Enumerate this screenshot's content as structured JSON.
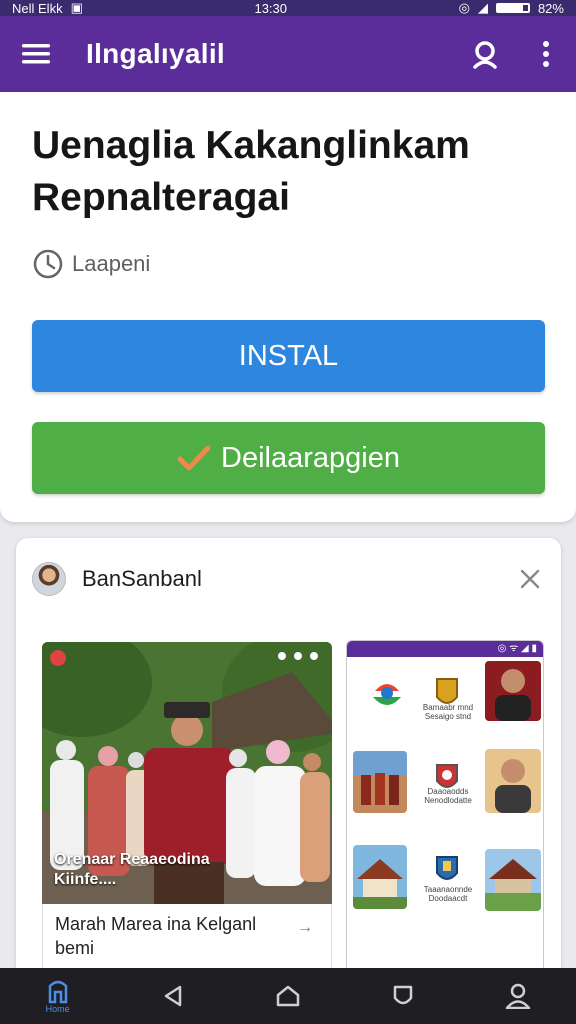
{
  "status_bar": {
    "left_text": "Nell Elkk",
    "time": "13:30",
    "battery_text": "82%",
    "battery_level": 0.82
  },
  "app_bar": {
    "title": "Ilngalıyalil",
    "menu_icon": "hamburger-menu-icon",
    "search_icon": "search-icon",
    "more_icon": "more-vertical-icon",
    "color": "#5b2d9a"
  },
  "app_detail": {
    "title": "Uenaglia Kakanglinkam Repnalteragai",
    "meta_icon": "clock-icon",
    "meta_text": "Laapeni",
    "install_label": "INSTAL",
    "secondary_label": "Deilaarapgien",
    "secondary_icon": "checkmark-icon",
    "install_color": "#2e86de",
    "secondary_color": "#4fae46"
  },
  "post": {
    "author": "BanSanbanl",
    "close_icon": "close-icon",
    "photo_overlay_line1": "Orenaar Reaaeodina",
    "photo_overlay_line2": "Kiinfe....",
    "caption_line1": "Marah Marea ina Kelganl",
    "caption_line2": "bemi",
    "caption_arrow": "→"
  },
  "phone_preview": {
    "status": "◎ ᯤ ◢ ▮",
    "labels": [
      "Bamaabr mnd Sesaigo stnd",
      "Daaoaodds Nenodlodatte",
      "Taaanaonnde Doodaacdt"
    ]
  },
  "bottom_nav": {
    "home_label": "Home",
    "items": [
      "home-icon",
      "back-icon",
      "nav-home-icon",
      "shield-icon",
      "profile-icon"
    ]
  }
}
